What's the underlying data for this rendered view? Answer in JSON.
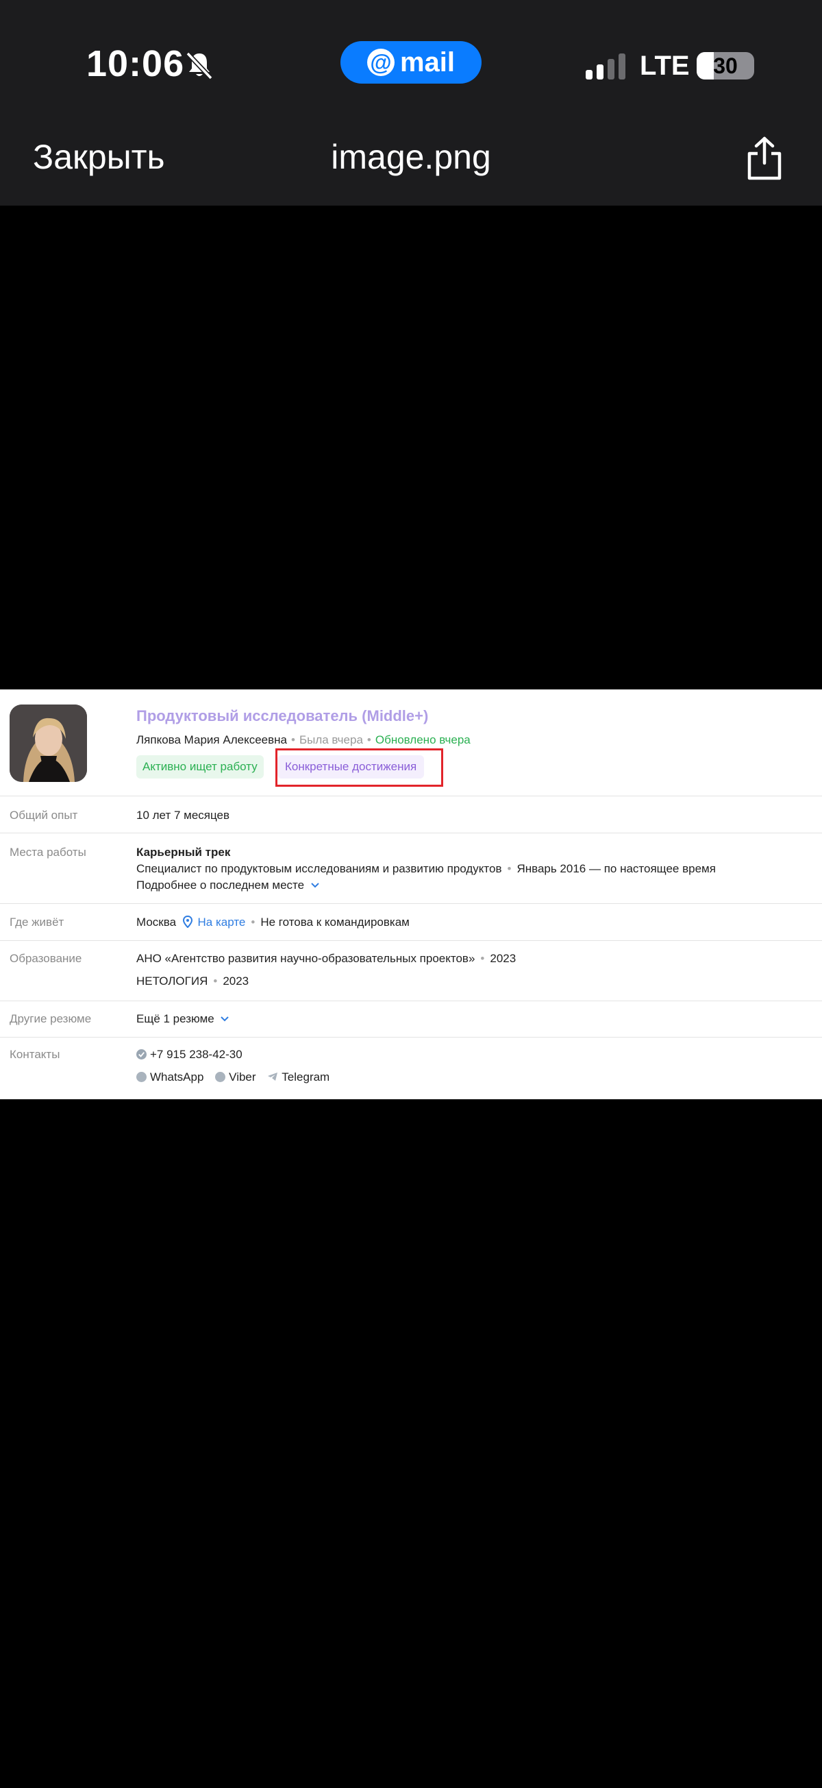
{
  "status_bar": {
    "time": "10:06",
    "app_pill": "mail",
    "network": "LTE",
    "battery": "30",
    "battery_level": 0.3
  },
  "nav": {
    "close_label": "Закрыть",
    "filename": "image.png"
  },
  "resume": {
    "title": "Продуктовый исследователь (Middle+)",
    "name": "Ляпкова Мария Алексеевна",
    "last_seen": "Была вчера",
    "updated": "Обновлено вчера",
    "tag_active": "Активно ищет работу",
    "tag_achievements": "Конкретные достижения",
    "experience_label": "Общий опыт",
    "experience_value": "10 лет 7 месяцев",
    "work_label": "Места работы",
    "company": "Карьерный трек",
    "position": "Специалист по продуктовым исследованиям и развитию продуктов",
    "period": "Январь 2016 — по настоящее время",
    "more_link": "Подробнее о последнем месте",
    "lives_label": "Где живёт",
    "city": "Москва",
    "map_link": "На карте",
    "travel": "Не готова к командировкам",
    "education_label": "Образование",
    "edu1_name": "АНО «Агентство развития научно-образовательных проектов»",
    "edu1_year": "2023",
    "edu2_name": "НЕТОЛОГИЯ",
    "edu2_year": "2023",
    "other_label": "Другие резюме",
    "other_link": "Ещё 1 резюме",
    "contacts_label": "Контакты",
    "phone": "+7 915 238-42-30",
    "messenger_1": "WhatsApp",
    "messenger_2": "Viber",
    "messenger_3": "Telegram"
  },
  "colors": {
    "accent_blue": "#0a7cff",
    "link_blue": "#2f7de1",
    "title_purple": "#b09ee6",
    "status_green": "#2bb052",
    "highlight_red": "#e2242a"
  }
}
